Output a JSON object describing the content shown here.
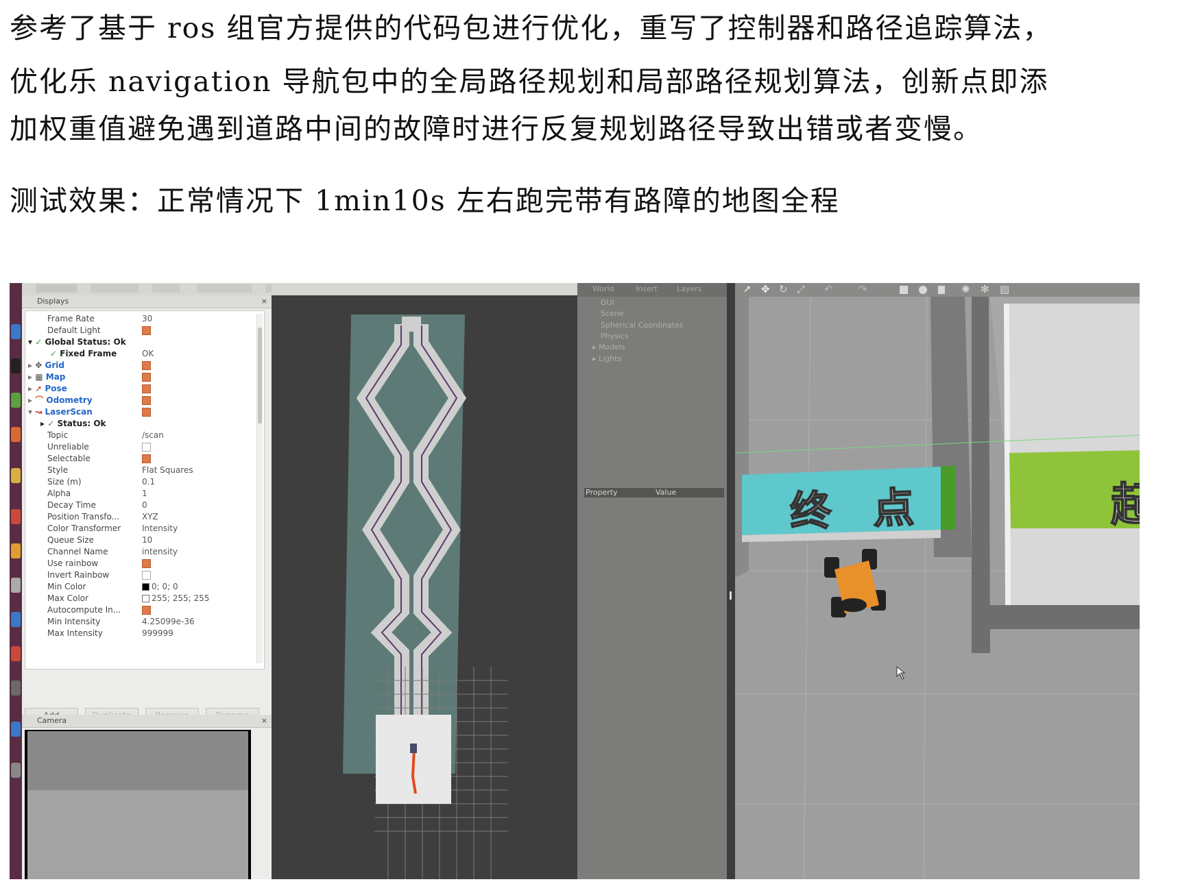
{
  "document": {
    "paragraph1": [
      "参考了基于 ros 组官方提供的代码包进行优化，重写了控制器和路径追踪算法，",
      "优化乐 navigation 导航包中的全局路径规划和局部路径规划算法，创新点即添",
      "加权重值避免遇到道路中间的故障时进行反复规划路径导致出错或者变慢。"
    ],
    "paragraph2": "测试效果：正常情况下 1min10s 左右跑完带有路障的地图全程"
  },
  "rviz": {
    "displays_title": "Displays",
    "properties": {
      "frame_rate": {
        "label": "Frame Rate",
        "value": "30"
      },
      "default_light": {
        "label": "Default Light"
      },
      "global_status": {
        "label": "Global Status: Ok"
      },
      "fixed_frame": {
        "label": "Fixed Frame",
        "value": "OK"
      },
      "grid": {
        "label": "Grid"
      },
      "map": {
        "label": "Map"
      },
      "pose": {
        "label": "Pose"
      },
      "odometry": {
        "label": "Odometry"
      },
      "laserscan": {
        "label": "LaserScan"
      },
      "status": {
        "label": "Status: Ok"
      },
      "topic": {
        "label": "Topic",
        "value": "/scan"
      },
      "unreliable": {
        "label": "Unreliable"
      },
      "selectable": {
        "label": "Selectable"
      },
      "style": {
        "label": "Style",
        "value": "Flat Squares"
      },
      "size": {
        "label": "Size (m)",
        "value": "0.1"
      },
      "alpha": {
        "label": "Alpha",
        "value": "1"
      },
      "decay_time": {
        "label": "Decay Time",
        "value": "0"
      },
      "position_transformer": {
        "label": "Position Transfo...",
        "value": "XYZ"
      },
      "color_transformer": {
        "label": "Color Transformer",
        "value": "Intensity"
      },
      "queue_size": {
        "label": "Queue Size",
        "value": "10"
      },
      "channel_name": {
        "label": "Channel Name",
        "value": "intensity"
      },
      "use_rainbow": {
        "label": "Use rainbow"
      },
      "invert_rainbow": {
        "label": "Invert Rainbow"
      },
      "min_color": {
        "label": "Min Color",
        "value": "0; 0; 0"
      },
      "max_color": {
        "label": "Max Color",
        "value": "255; 255; 255"
      },
      "autocompute": {
        "label": "Autocompute In..."
      },
      "min_intensity": {
        "label": "Min Intensity",
        "value": "4.25099e-36"
      },
      "max_intensity": {
        "label": "Max Intensity",
        "value": "999999"
      }
    },
    "buttons": {
      "add": "Add",
      "duplicate": "Duplicate",
      "remove": "Remove",
      "rename": "Rename"
    },
    "camera_title": "Camera"
  },
  "gazebo": {
    "tabs": [
      "World",
      "Insert",
      "Layers"
    ],
    "tree": [
      "GUI",
      "Scene",
      "Spherical Coordinates",
      "Physics",
      "Models",
      "Lights"
    ],
    "property_header": {
      "property": "Property",
      "value": "Value"
    },
    "sign_finish": "终 点",
    "sign_start_partial": "起",
    "colors": {
      "finish_sign": "#5fc8cc",
      "start_sign": "#8fc43a",
      "robot_body": "#e8902a"
    }
  }
}
